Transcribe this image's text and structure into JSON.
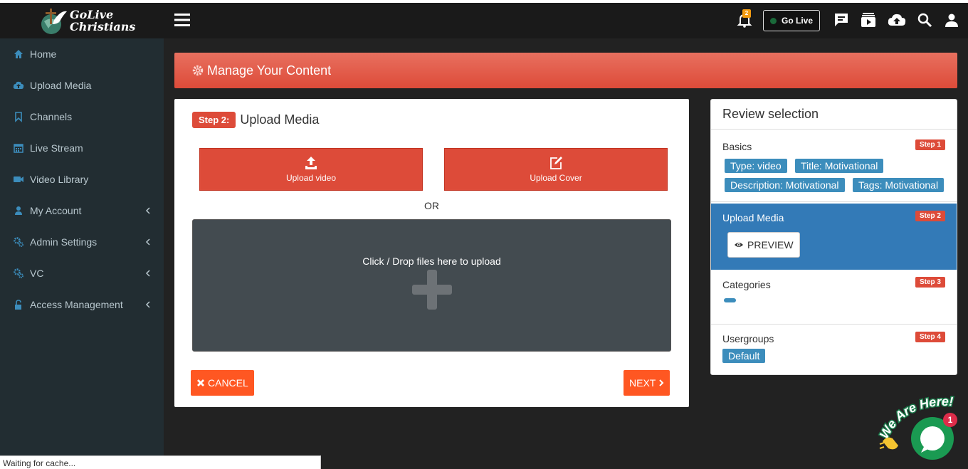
{
  "brand": {
    "line1": "GoLive",
    "line2": "Christians"
  },
  "nav": [
    {
      "label": "Home",
      "icon": "home-icon"
    },
    {
      "label": "Upload Media",
      "icon": "cloud-upload-icon"
    },
    {
      "label": "Channels",
      "icon": "bookmark-icon"
    },
    {
      "label": "Live Stream",
      "icon": "calendar-icon"
    },
    {
      "label": "Video Library",
      "icon": "video-camera-icon"
    },
    {
      "label": "My Account",
      "icon": "user-icon"
    },
    {
      "label": "Admin Settings",
      "icon": "cogs-icon"
    },
    {
      "label": "VC",
      "icon": "cogs-icon"
    },
    {
      "label": "Access Management",
      "icon": "unlock-icon"
    }
  ],
  "topbar": {
    "notification_count": "2",
    "go_live_label": "Go Live"
  },
  "header": {
    "title": "Manage Your Content"
  },
  "main": {
    "step_badge": "Step 2:",
    "step_title": "Upload Media",
    "upload_video": "Upload video",
    "upload_cover": "Upload Cover",
    "or": "OR",
    "dropzone_text": "Click / Drop files here to upload",
    "cancel": "CANCEL",
    "next": "NEXT"
  },
  "review": {
    "title": "Review selection",
    "basics": {
      "name": "Basics",
      "step": "Step 1",
      "tags": [
        "Type: video",
        "Title: Motivational",
        "Description: Motivational",
        "Tags: Motivational"
      ]
    },
    "upload": {
      "name": "Upload Media",
      "step": "Step 2",
      "preview": "PREVIEW"
    },
    "categories": {
      "name": "Categories",
      "step": "Step 3"
    },
    "usergroups": {
      "name": "Usergroups",
      "step": "Step 4",
      "tag": "Default"
    }
  },
  "status_text": "Waiting for cache...",
  "chat": {
    "badge": "1",
    "label": "We Are Here!"
  },
  "colors": {
    "accent_red": "#dd4b39",
    "action_orange": "#ff5722",
    "blue": "#3c8dbc",
    "sidebar": "#222d32",
    "nav_icon": "#3c8dbc"
  }
}
